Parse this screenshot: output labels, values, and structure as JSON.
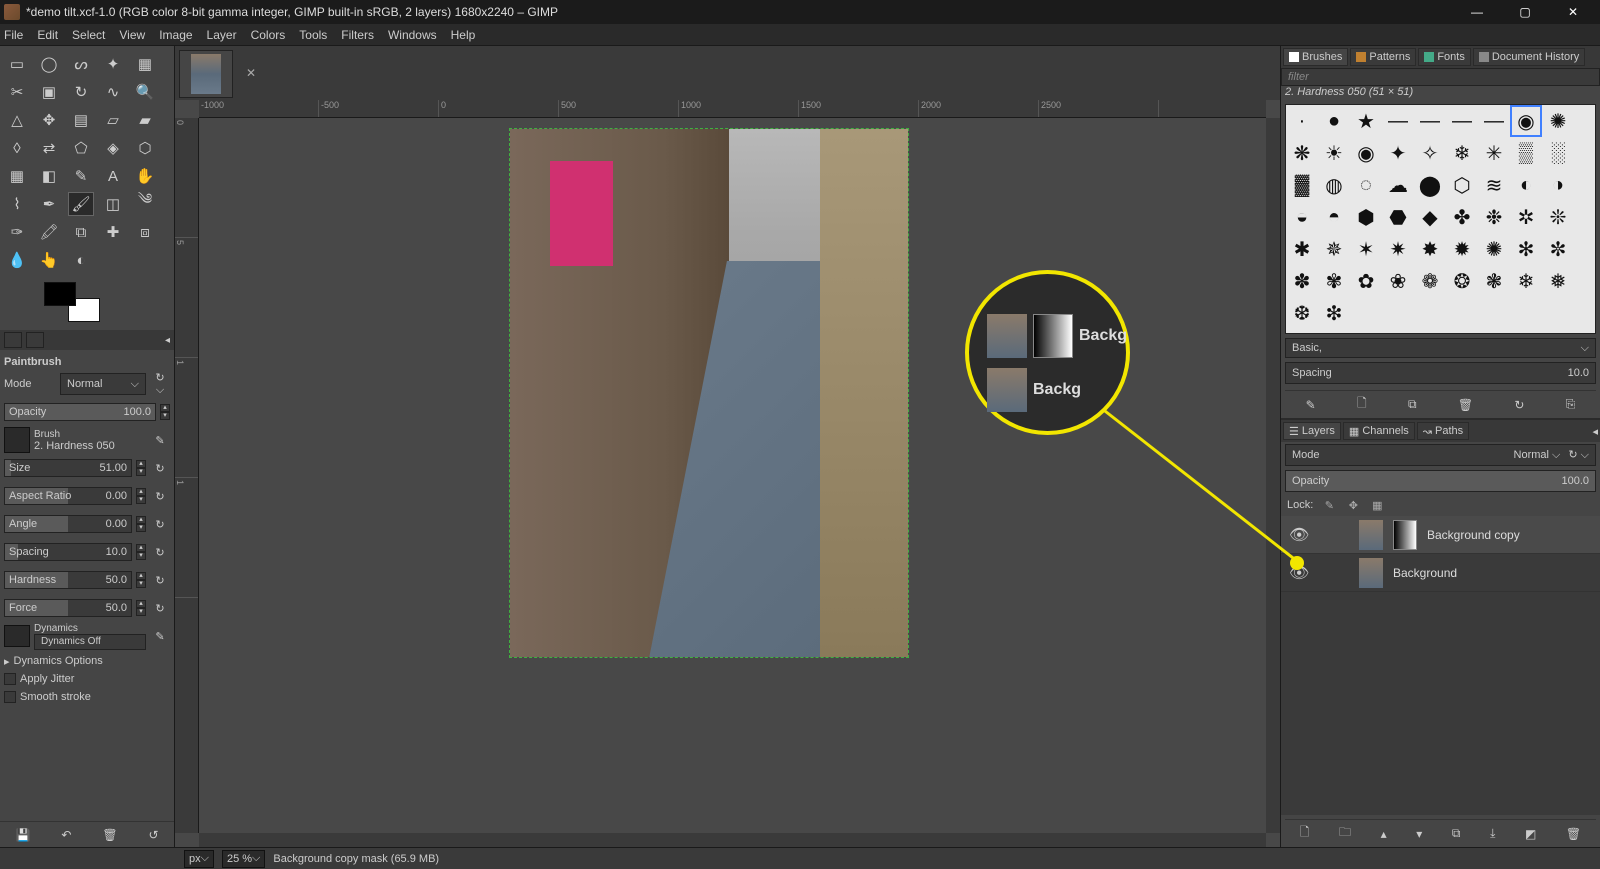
{
  "window": {
    "title": "*demo tilt.xcf-1.0 (RGB color 8-bit gamma integer, GIMP built-in sRGB, 2 layers) 1680x2240 – GIMP"
  },
  "menu": [
    "File",
    "Edit",
    "Select",
    "View",
    "Image",
    "Layer",
    "Colors",
    "Tools",
    "Filters",
    "Windows",
    "Help"
  ],
  "toolOptions": {
    "toolName": "Paintbrush",
    "mode_label": "Mode",
    "mode_value": "Normal",
    "opacity_label": "Opacity",
    "opacity_value": "100.0",
    "brush_label": "Brush",
    "brush_name": "2. Hardness 050",
    "size_label": "Size",
    "size_value": "51.00",
    "aspect_label": "Aspect Ratio",
    "aspect_value": "0.00",
    "angle_label": "Angle",
    "angle_value": "0.00",
    "spacing_label": "Spacing",
    "spacing_value": "10.0",
    "hardness_label": "Hardness",
    "hardness_value": "50.0",
    "force_label": "Force",
    "force_value": "50.0",
    "dynamics_label": "Dynamics",
    "dynamics_value": "Dynamics Off",
    "dyn_options": "Dynamics Options",
    "apply_jitter": "Apply Jitter",
    "smooth_stroke": "Smooth stroke"
  },
  "ruler_h": [
    "-1000",
    "-500",
    "0",
    "500",
    "1000",
    "1500",
    "2000",
    "2500"
  ],
  "ruler_v": [
    "0",
    "5",
    "1",
    "1"
  ],
  "status": {
    "units": "px",
    "zoom": "25 %",
    "msg": "Background copy mask (65.9 MB)"
  },
  "brushesPanel": {
    "tabs": [
      "Brushes",
      "Patterns",
      "Fonts",
      "Document History"
    ],
    "filter_placeholder": "filter",
    "selected_brush_label": "2. Hardness 050 (51 × 51)",
    "mode_value": "Basic,",
    "spacing_label": "Spacing",
    "spacing_value": "10.0"
  },
  "layersPanel": {
    "tabs": [
      "Layers",
      "Channels",
      "Paths"
    ],
    "mode_label": "Mode",
    "mode_value": "Normal",
    "opacity_label": "Opacity",
    "opacity_value": "100.0",
    "lock_label": "Lock:",
    "layers": [
      {
        "name": "Background copy",
        "hasMask": true
      },
      {
        "name": "Background",
        "hasMask": false
      }
    ]
  },
  "callout": {
    "zoom_layer_a": "Backg",
    "zoom_layer_b": "Backg"
  }
}
